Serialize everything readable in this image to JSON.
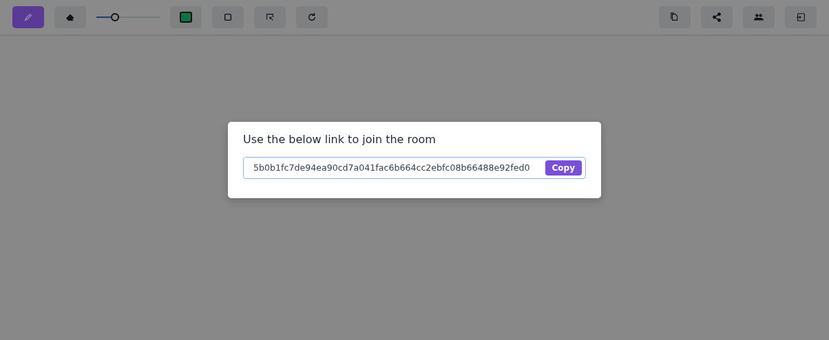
{
  "toolbar": {
    "tools": [
      {
        "kind": "pencil",
        "selected": true
      },
      {
        "kind": "eraser",
        "selected": false
      }
    ],
    "stroke_width": {
      "level": 0.27
    },
    "stroke_color": {
      "color": "#0d7347"
    },
    "shapes": [
      {
        "kind": "rectangle",
        "selected": false
      },
      {
        "kind": "select",
        "selected": false
      },
      {
        "kind": "redo",
        "selected": false
      }
    ],
    "actions": [
      {
        "kind": "copy"
      },
      {
        "kind": "share"
      },
      {
        "kind": "users"
      },
      {
        "kind": "exit"
      }
    ]
  },
  "dialog": {
    "title": "Use the below link to join the room",
    "link": "5b0b1fc7de94ea90cd7a041fac6b664cc2ebfc08b66488e92fed0",
    "button": "Copy"
  }
}
